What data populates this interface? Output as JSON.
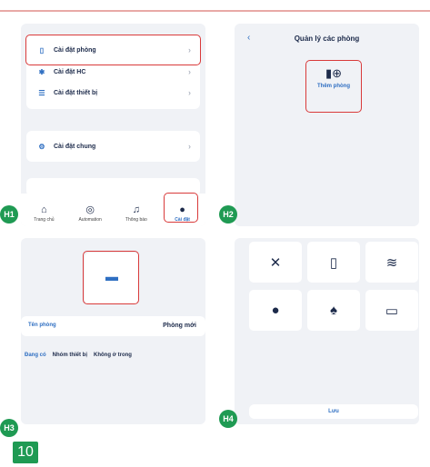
{
  "panel1": {
    "badge": "H1",
    "items": [
      {
        "label": "Cài đặt phòng",
        "icon": "door-icon"
      },
      {
        "label": "Cài đặt HC",
        "icon": "bluetooth-icon"
      },
      {
        "label": "Cài đặt thiết bị",
        "icon": "device-icon"
      },
      {
        "label": "Cài đặt chung",
        "icon": "gear-icon"
      }
    ],
    "tabs": [
      {
        "label": "Trang chủ",
        "icon": "home-icon"
      },
      {
        "label": "Automation",
        "icon": "automation-icon"
      },
      {
        "label": "Thông báo",
        "icon": "bell-icon"
      },
      {
        "label": "Cài đặt",
        "icon": "person-icon"
      }
    ]
  },
  "panel2": {
    "badge": "H2",
    "title": "Quản lý các phòng",
    "add_room_label": "Thêm phòng"
  },
  "panel3": {
    "badge": "H3",
    "room_name_label": "Tên phòng",
    "room_name_value": "Phòng mới",
    "tabs": [
      "Đang có",
      "Nhóm thiết bị",
      "Không ở trong"
    ]
  },
  "panel4": {
    "badge": "H4",
    "save_label": "Lưu",
    "tiles": [
      "tools-icon",
      "fridge-icon",
      "pool-icon",
      "lamp-icon",
      "trees-icon",
      "box-icon"
    ]
  },
  "page_number": "10"
}
